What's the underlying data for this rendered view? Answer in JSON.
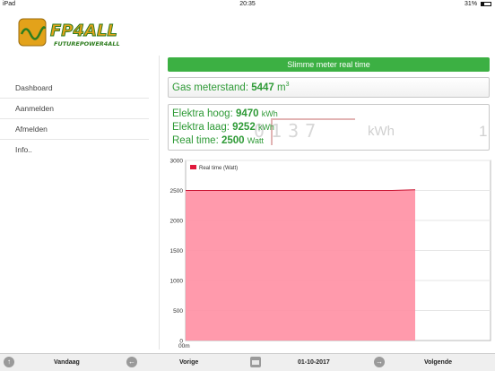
{
  "statusbar": {
    "device": "iPad",
    "time": "20:35",
    "battery": "31%"
  },
  "header": {
    "logo_text": "FP4ALL",
    "logo_subtitle": "FUTUREPOWER4ALL"
  },
  "sidebar": {
    "items": [
      {
        "label": "Dashboard"
      },
      {
        "label": "Aanmelden"
      },
      {
        "label": "Afmelden"
      },
      {
        "label": "Info.."
      }
    ]
  },
  "main": {
    "title": "Slimme meter real time",
    "gas": {
      "label": "Gas meterstand:",
      "value": "5447",
      "unit": "m",
      "unit_sup": "3"
    },
    "electricity": {
      "high": {
        "label": "Elektra hoog:",
        "value": "9470",
        "unit": "kWh"
      },
      "low": {
        "label": "Elektra laag:",
        "value": "9252",
        "unit": "kWh"
      },
      "realtime": {
        "label": "Real time:",
        "value": "2500",
        "unit": "Watt"
      }
    },
    "meter_background": {
      "digits": "0137",
      "unit": "kWh",
      "extra": "1"
    }
  },
  "chart_data": {
    "type": "area",
    "series": [
      {
        "name": "Real time (Watt)",
        "color": "#ff8fa3",
        "line_color": "#c8102e",
        "values": [
          2500,
          2500,
          2500,
          2500,
          2500,
          2500,
          2500,
          2500,
          2500,
          2500,
          2510
        ]
      }
    ],
    "x_tick_labels": [
      "00m"
    ],
    "y_ticks": [
      0,
      500,
      1000,
      1500,
      2000,
      2500,
      3000
    ],
    "ylim": [
      0,
      3000
    ],
    "grid": true,
    "legend": "top-left"
  },
  "toolbar": {
    "today_label": "Vandaag",
    "prev_label": "Vorige",
    "date_label": "01-10-2017",
    "next_label": "Volgende"
  }
}
